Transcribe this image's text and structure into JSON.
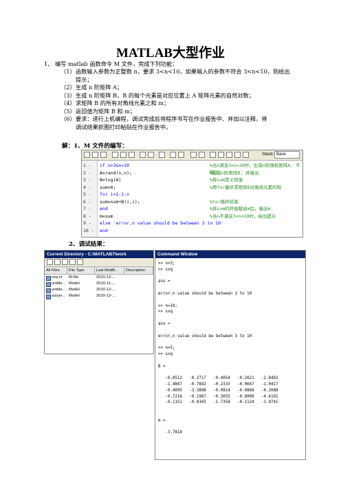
{
  "title": "MATLAB大型作业",
  "task": {
    "intro": "1、 编写 matlab 函数命令 M 文件，完成下列功能：",
    "items": [
      {
        "num": "（1）",
        "text": "函数输入参数为正整数 n，要求 3<n<10，如果输入的参数不符合 3<n<10，则给出"
      },
      {
        "num": "",
        "text": "提示；"
      },
      {
        "num": "（2）",
        "text": "生成 n 阶矩阵 A；"
      },
      {
        "num": "（3）",
        "text": "生成 n 阶矩阵 B，B 的每个元素是对应位置上 A 矩阵元素的自然对数；"
      },
      {
        "num": "（4）",
        "text": "求矩阵 B 的所有对角线元素之和 m；"
      },
      {
        "num": "（5）",
        "text": "返回值为矩阵 B 和 m；"
      },
      {
        "num": "（6）",
        "text": "要求：进行上机编程，调试完成后将程序书写在作业报告中、并加以注释，将"
      },
      {
        "num": "",
        "text": "调试结果抓图打印粘贴在作业报告中。"
      }
    ]
  },
  "sections": {
    "solution": "解：1、M 文件的编写：",
    "debug": "2、调试结果："
  },
  "editor": {
    "stack_label": "Stack:",
    "stack_value": "Base",
    "lines": [
      {
        "n": "1 -",
        "code": "if n>3&n<10",
        "comment": "%当n满足3<n<10时，生成n阶随机矩阵A, 不输出"
      },
      {
        "n": "2 -",
        "code": "A=rand(n,n);",
        "comment": "%生成n阶矩阵B, 并输出"
      },
      {
        "n": "3 -",
        "code": "B=log(A)",
        "comment": "%将sum定义初值"
      },
      {
        "n": "4 -",
        "code": "sum=0;",
        "comment": "%用for循环求矩阵B对角线元素的和"
      },
      {
        "n": "5 -",
        "code": "for i=1:1:n",
        "comment": ""
      },
      {
        "n": "6 -",
        "code": "sum=sum+B(i,i);",
        "comment": "%for循环结束"
      },
      {
        "n": "7 -",
        "code": "end",
        "comment": "%将sum的终值赋给m后，输出m"
      },
      {
        "n": "8 -",
        "code": "m=sum",
        "comment": "%当n不满足3<n<10时，给出提示"
      },
      {
        "n": "9 -",
        "code": "else 'error,n value should be between 3 to 10'",
        "comment": ""
      },
      {
        "n": "10 -",
        "code": "end",
        "comment": ""
      }
    ]
  },
  "current_directory": {
    "title": "Current Directory - C:\\MATLAB7\\work",
    "columns": [
      "All Files",
      "File Type",
      "Last Modifi...",
      "Description"
    ],
    "files": [
      {
        "name": "sxq.m",
        "type": "M-file",
        "modified": "2010-12-..."
      },
      {
        "name": "untitle...",
        "type": "Model",
        "modified": "2010-11-..."
      },
      {
        "name": "untitle...",
        "type": "Model",
        "modified": "2010-12-..."
      },
      {
        "name": "zuoye...",
        "type": "Model",
        "modified": "2010-12-..."
      }
    ]
  },
  "command_window": {
    "title": "Command Window",
    "lines": [
      ">> n=3;",
      ">> sxq",
      "",
      "ans =",
      "",
      "error,n value should be between 3 to 10",
      "",
      ">> n=10;",
      ">> sxq",
      "",
      "ans =",
      "",
      "error,n value should be between 3 to 10",
      "",
      ">> n=5;",
      ">> sxq",
      "",
      "B =",
      "",
      "   -0.0512   -0.2717   -0.4054   -0.2021   -2.8492",
      "   -1.4047   -0.7842   -0.2333   -0.0667   -1.0417",
      "   -0.4095   -3.3898   -0.0814   -0.0868   -0.2088",
      "   -0.7216   -0.1967   -0.3035   -0.8909   -4.6191",
      "   -0.1151   -0.8103   -1.7358   -0.1124   -1.9741",
      "",
      "",
      "m =",
      "",
      "   -3.7818"
    ]
  }
}
